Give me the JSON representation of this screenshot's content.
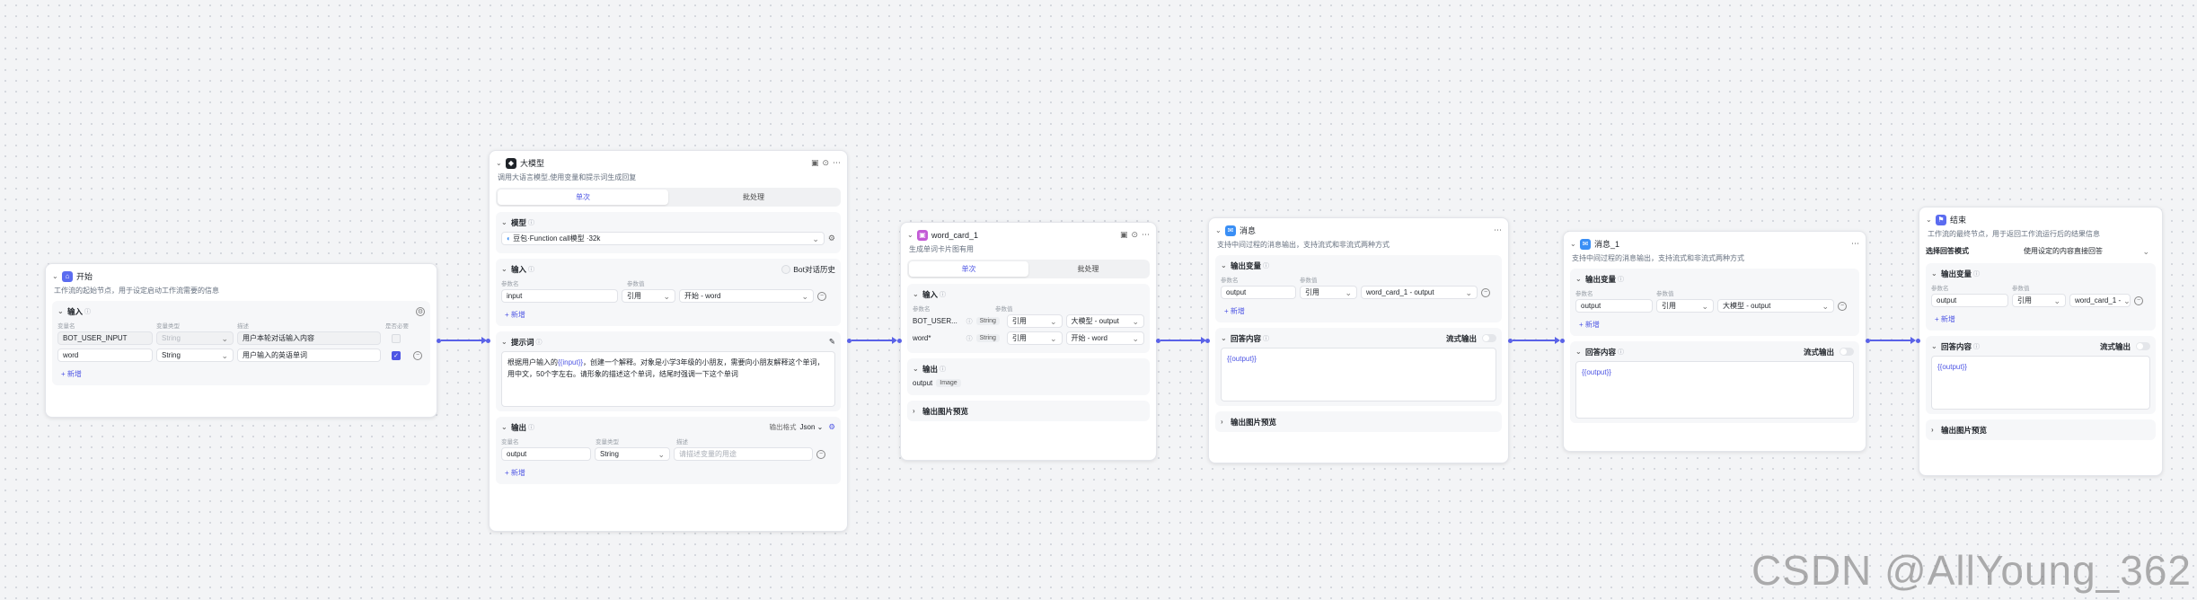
{
  "start": {
    "title": "开始",
    "desc": "工作流的起始节点，用于设定启动工作流需要的信息",
    "input_label": "输入",
    "col_name": "变量名",
    "col_type": "变量类型",
    "col_desc": "描述",
    "col_required": "是否必要",
    "rows": [
      {
        "name": "BOT_USER_INPUT",
        "type": "String",
        "desc": "用户本轮对话输入内容"
      },
      {
        "name": "word",
        "type": "String",
        "desc": "用户输入的英语单词"
      }
    ],
    "add_label": "+ 新增"
  },
  "llm": {
    "title": "大模型",
    "desc": "调用大语言模型,使用变量和提示词生成回复",
    "tab_single": "单次",
    "tab_batch": "批处理",
    "model_label": "模型",
    "model_value": "豆包·Function call模型 ·32k",
    "input_label": "输入",
    "bool_label": "Bot对话历史",
    "col_name": "参数名",
    "col_value": "参数值",
    "input_name": "input",
    "input_ref": "引用",
    "input_value": "开始 - word",
    "add_label": "+ 新增",
    "prompt_label": "提示词",
    "prompt_pre": "根据用户输入的",
    "prompt_var": "{{input}}",
    "prompt_post": "，创建一个解释。对象是小学3年级的小朋友，需要向小朋友解释这个单词，用中文，50个字左右。请形象的描述这个单词，结尾时强调一下这个单词",
    "output_label": "输出",
    "output_mode_label": "输出格式",
    "output_mode": "Json",
    "col_vname": "变量名",
    "col_vtype": "变量类型",
    "col_vdesc": "描述",
    "out_name": "output",
    "out_type": "String",
    "out_desc_ph": "请描述变量的用途"
  },
  "card": {
    "title": "word_card_1",
    "desc": "生成单词卡片图有用",
    "tab_single": "单次",
    "tab_batch": "批处理",
    "input_label": "输入",
    "col_name": "参数名",
    "col_value": "参数值",
    "rows": [
      {
        "name": "BOT_USER...",
        "type": "String",
        "ref": "引用",
        "value": "大模型 - output"
      },
      {
        "name": "word*",
        "type": "String",
        "ref": "引用",
        "value": "开始 - word"
      }
    ],
    "output_label": "输出",
    "out_name": "output",
    "out_type": "Image",
    "preview_label": "输出图片预览"
  },
  "msg1": {
    "title": "消息",
    "desc": "支持中间过程的消息输出，支持流式和非流式两种方式",
    "outvar_label": "输出变量",
    "col_name": "参数名",
    "col_value": "参数值",
    "var_name": "output",
    "var_ref": "引用",
    "var_value": "word_card_1 - output",
    "add_label": "+ 新增",
    "reply_label": "回答内容",
    "stream_label": "流式输出",
    "reply_text": "{{output}}",
    "preview_label": "输出图片预览"
  },
  "msg2": {
    "title": "消息_1",
    "desc": "支持中间过程的消息输出，支持流式和非流式两种方式",
    "outvar_label": "输出变量",
    "col_name": "参数名",
    "col_value": "参数值",
    "var_name": "output",
    "var_ref": "引用",
    "var_value": "大模型 - output",
    "add_label": "+ 新增",
    "reply_label": "回答内容",
    "stream_label": "流式输出",
    "reply_text": "{{output}}"
  },
  "end": {
    "title": "结束",
    "desc": "工作流的最终节点，用于返回工作流运行后的结果信息",
    "mode_label": "选择回答模式",
    "mode_value": "使用设定的内容直接回答",
    "outvar_label": "输出变量",
    "col_name": "参数名",
    "col_value": "参数值",
    "var_name": "output",
    "var_ref": "引用",
    "var_value": "word_card_1 -",
    "add_label": "+ 新增",
    "reply_label": "回答内容",
    "stream_label": "流式输出",
    "reply_text": "{{output}}",
    "preview_label": "输出图片预览"
  },
  "watermark": "CSDN @AllYoung_362",
  "colors": {
    "accent": "#4e56e4",
    "start_icon": "#5b6cf0",
    "llm_icon": "#1f2329",
    "card_icon": "#c35ad6",
    "msg_icon": "#3a8ff5",
    "end_icon": "#5b6cf0"
  }
}
